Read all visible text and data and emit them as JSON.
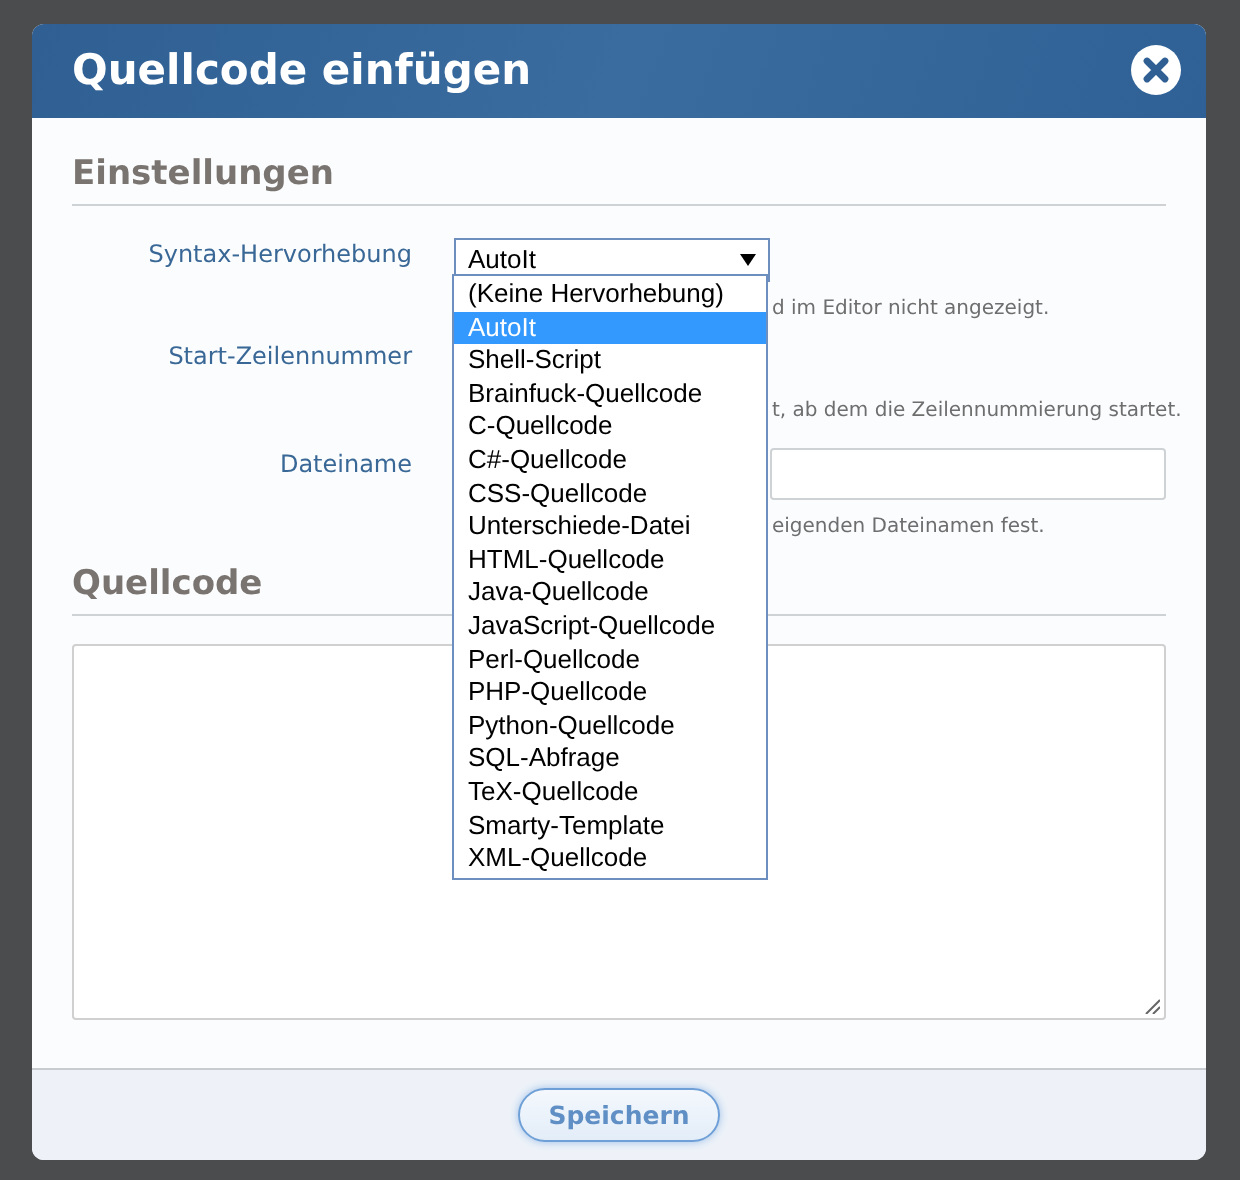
{
  "dialog": {
    "title": "Quellcode einfügen"
  },
  "settings": {
    "title": "Einstellungen",
    "fields": [
      {
        "label": "Syntax-Hervorhebung",
        "kind": "select",
        "value": "AutoIt",
        "hint": "d im Editor nicht angezeigt."
      },
      {
        "label": "Start-Zeilennummer",
        "kind": "covered",
        "hint": "t, ab dem die Zeilennummierung startet."
      },
      {
        "label": "Dateiname",
        "kind": "text",
        "hint": "eigenden Dateinamen fest."
      }
    ]
  },
  "dropdown": {
    "options": [
      {
        "label": "(Keine Hervorhebung)",
        "selected": false
      },
      {
        "label": "AutoIt",
        "selected": true
      },
      {
        "label": "Shell-Script",
        "selected": false
      },
      {
        "label": "Brainfuck-Quellcode",
        "selected": false
      },
      {
        "label": "C-Quellcode",
        "selected": false
      },
      {
        "label": "C#-Quellcode",
        "selected": false
      },
      {
        "label": "CSS-Quellcode",
        "selected": false
      },
      {
        "label": "Unterschiede-Datei",
        "selected": false
      },
      {
        "label": "HTML-Quellcode",
        "selected": false
      },
      {
        "label": "Java-Quellcode",
        "selected": false
      },
      {
        "label": "JavaScript-Quellcode",
        "selected": false
      },
      {
        "label": "Perl-Quellcode",
        "selected": false
      },
      {
        "label": "PHP-Quellcode",
        "selected": false
      },
      {
        "label": "Python-Quellcode",
        "selected": false
      },
      {
        "label": "SQL-Abfrage",
        "selected": false
      },
      {
        "label": "TeX-Quellcode",
        "selected": false
      },
      {
        "label": "Smarty-Template",
        "selected": false
      },
      {
        "label": "XML-Quellcode",
        "selected": false
      }
    ]
  },
  "code": {
    "title": "Quellcode"
  },
  "save_button": "Speichern"
}
